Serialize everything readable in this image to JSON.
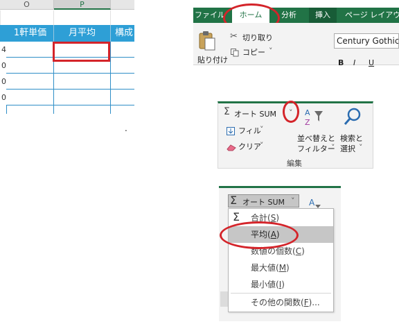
{
  "sheet": {
    "columns": [
      "O",
      "P",
      ""
    ],
    "row_numbers": [
      "4",
      "0",
      "0",
      "0"
    ],
    "headers": [
      "1軒単価",
      "月平均",
      "構成"
    ],
    "dot": "."
  },
  "ribbon_top": {
    "tabs": [
      "ファイル",
      "ホーム",
      "分析",
      "挿入",
      "ページ レイアウ"
    ],
    "paste_label": "貼り付け",
    "cut_label": "切り取り",
    "copy_label": "コピー",
    "copy_arrow": "˅",
    "font_name": "Century Gothic",
    "bold": "B",
    "italic": "I",
    "underline": "U"
  },
  "edit_group": {
    "autosum": "オート SUM",
    "autosum_arrow": "˅",
    "fill": "フィル",
    "fill_arrow": "˅",
    "clear": "クリア",
    "clear_arrow": "˅",
    "sort_line1": "並べ替えと",
    "sort_line2": "フィルター",
    "sort_arrow": "˅",
    "find_line1": "検索と",
    "find_line2": "選択",
    "find_arrow": "˅",
    "group_label": "編集"
  },
  "dropdown": {
    "autosum": "オート SUM",
    "arrow": "˅",
    "items": [
      {
        "pre": "合計(",
        "key": "S",
        "post": ")"
      },
      {
        "pre": "平均(",
        "key": "A",
        "post": ")"
      },
      {
        "pre": "数値の個数(",
        "key": "C",
        "post": ")"
      },
      {
        "pre": "最大値(",
        "key": "M",
        "post": ")"
      },
      {
        "pre": "最小値(",
        "key": "I",
        "post": ")"
      },
      {
        "pre": "その他の関数(",
        "key": "F",
        "post": ")..."
      }
    ],
    "highlighted": "平均(A)"
  },
  "colors": {
    "excel_green": "#217346",
    "header_blue": "#2e9fd6",
    "annotation_red": "#d4242a",
    "menu_highlight": "#c6c6c6"
  }
}
